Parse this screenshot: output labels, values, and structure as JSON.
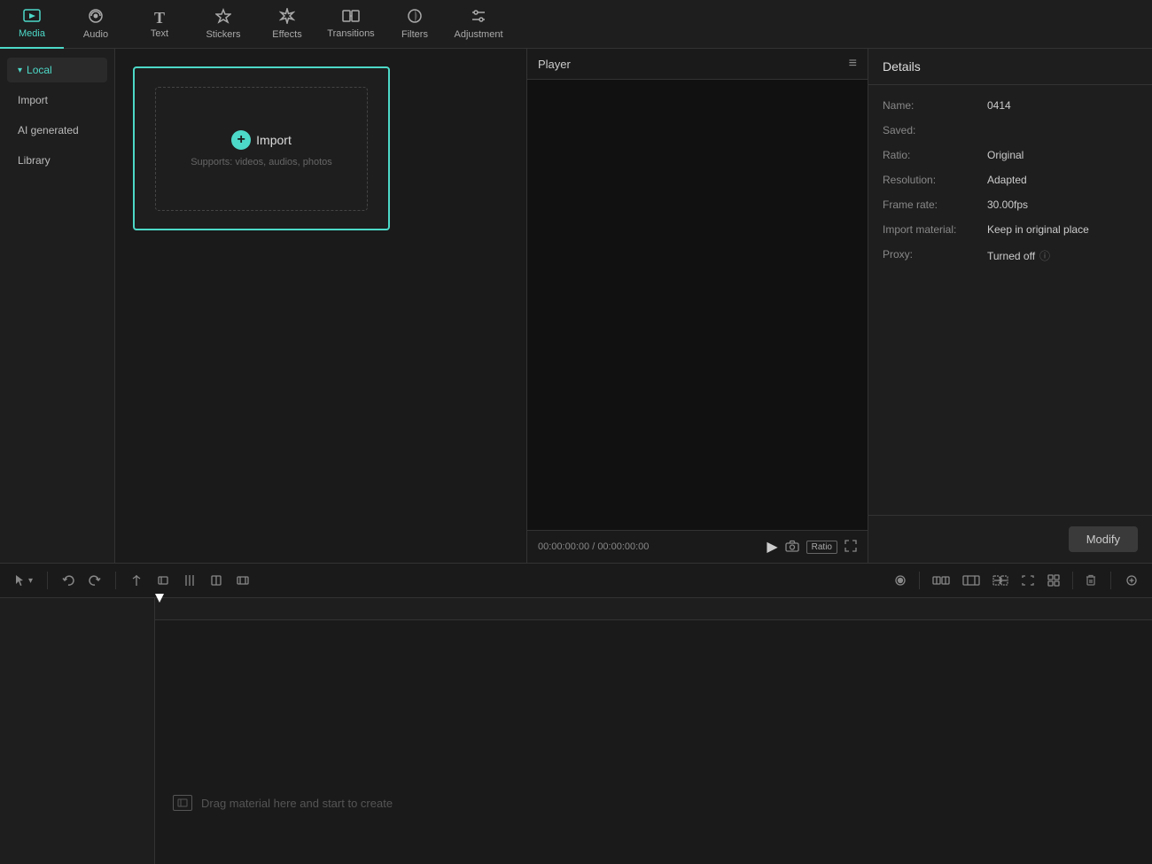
{
  "nav": {
    "items": [
      {
        "id": "media",
        "label": "Media",
        "icon": "🎬",
        "active": true
      },
      {
        "id": "audio",
        "label": "Audio",
        "icon": "🎵",
        "active": false
      },
      {
        "id": "text",
        "label": "Text",
        "icon": "T",
        "active": false
      },
      {
        "id": "stickers",
        "label": "Stickers",
        "icon": "⭐",
        "active": false
      },
      {
        "id": "effects",
        "label": "Effects",
        "icon": "✨",
        "active": false
      },
      {
        "id": "transitions",
        "label": "Transitions",
        "icon": "⏩",
        "active": false
      },
      {
        "id": "filters",
        "label": "Filters",
        "icon": "🎨",
        "active": false
      },
      {
        "id": "adjustment",
        "label": "Adjustment",
        "icon": "⚙",
        "active": false
      }
    ]
  },
  "sidebar": {
    "items": [
      {
        "id": "local",
        "label": "Local",
        "active": true
      },
      {
        "id": "import",
        "label": "Import",
        "active": false
      },
      {
        "id": "ai-generated",
        "label": "AI generated",
        "active": false
      },
      {
        "id": "library",
        "label": "Library",
        "active": false
      }
    ]
  },
  "media": {
    "import_label": "Import",
    "import_sub": "Supports: videos, audios, photos"
  },
  "player": {
    "title": "Player",
    "time_current": "00:00:00:00",
    "time_total": "00:00:00:00",
    "ratio_label": "Ratio"
  },
  "details": {
    "title": "Details",
    "fields": [
      {
        "label": "Name:",
        "value": "0414"
      },
      {
        "label": "Saved:",
        "value": ""
      },
      {
        "label": "Ratio:",
        "value": "Original"
      },
      {
        "label": "Resolution:",
        "value": "Adapted"
      },
      {
        "label": "Frame rate:",
        "value": "30.00fps"
      },
      {
        "label": "Import material:",
        "value": "Keep in original place"
      },
      {
        "label": "Proxy:",
        "value": "Turned off",
        "has_info": true
      }
    ],
    "modify_btn": "Modify"
  },
  "timeline": {
    "drag_hint": "Drag material here and start to create"
  }
}
